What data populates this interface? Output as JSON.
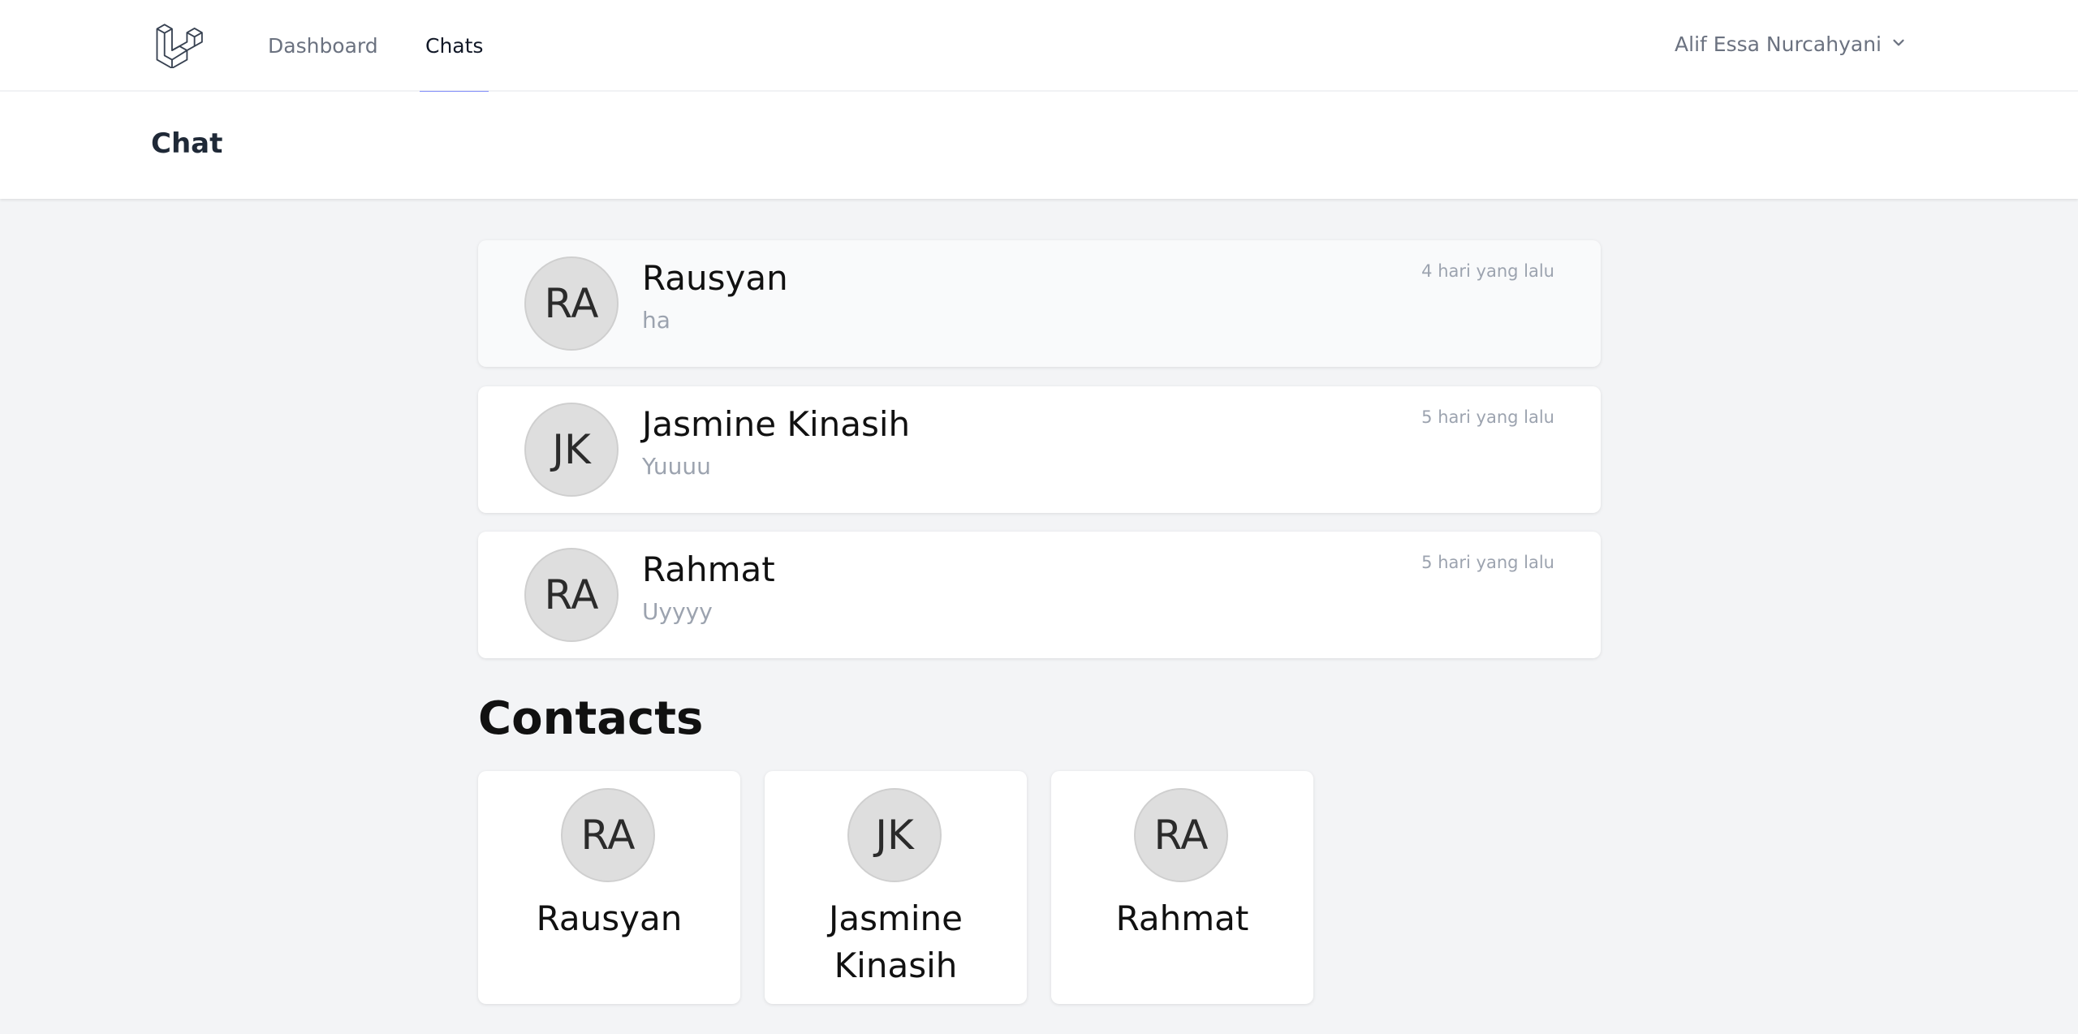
{
  "nav": {
    "links": [
      {
        "label": "Dashboard"
      },
      {
        "label": "Chats",
        "active": true
      }
    ],
    "user_name": "Alif Essa Nurcahyani",
    "accent_color": "#818cf8"
  },
  "header": {
    "title": "Chat"
  },
  "chats": [
    {
      "initials": "RA",
      "name": "Rausyan",
      "last_message": "ha",
      "time": "4 hari yang lalu",
      "active": true
    },
    {
      "initials": "JK",
      "name": "Jasmine Kinasih",
      "last_message": "Yuuuu",
      "time": "5 hari yang lalu"
    },
    {
      "initials": "RA",
      "name": "Rahmat",
      "last_message": "Uyyyy",
      "time": "5 hari yang lalu"
    }
  ],
  "contacts": {
    "title": "Contacts",
    "items": [
      {
        "initials": "RA",
        "name": "Rausyan"
      },
      {
        "initials": "JK",
        "name": "Jasmine Kinasih"
      },
      {
        "initials": "RA",
        "name": "Rahmat"
      }
    ]
  }
}
